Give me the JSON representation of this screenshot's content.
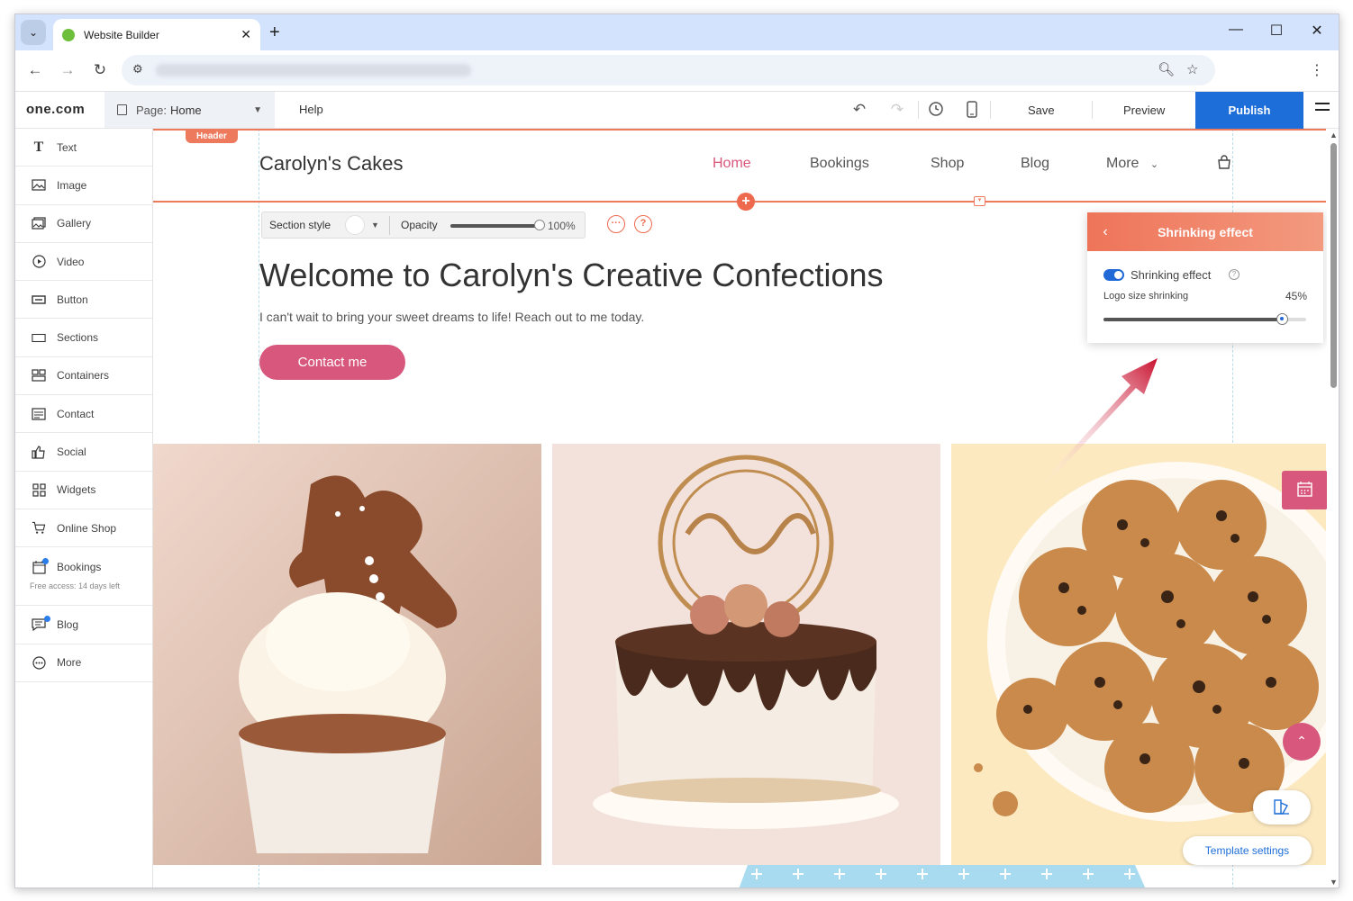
{
  "browser": {
    "tab_title": "Website Builder",
    "new_tab": "+",
    "window_controls": {
      "minimize": "—",
      "maximize": "☐",
      "close": "✕"
    }
  },
  "builder": {
    "logo": "one.com",
    "page_label": "Page:",
    "page_value": "Home",
    "help": "Help",
    "save": "Save",
    "preview": "Preview",
    "publish": "Publish"
  },
  "sidebar": {
    "items": [
      {
        "label": "Text",
        "icon": "text-icon"
      },
      {
        "label": "Image",
        "icon": "image-icon"
      },
      {
        "label": "Gallery",
        "icon": "gallery-icon"
      },
      {
        "label": "Video",
        "icon": "video-icon"
      },
      {
        "label": "Button",
        "icon": "button-icon"
      },
      {
        "label": "Sections",
        "icon": "sections-icon"
      },
      {
        "label": "Containers",
        "icon": "containers-icon"
      },
      {
        "label": "Contact",
        "icon": "contact-icon"
      },
      {
        "label": "Social",
        "icon": "social-icon"
      },
      {
        "label": "Widgets",
        "icon": "widgets-icon"
      },
      {
        "label": "Online Shop",
        "icon": "cart-icon"
      },
      {
        "label": "Bookings",
        "icon": "bookings-icon",
        "sub": "Free access: 14 days left"
      },
      {
        "label": "Blog",
        "icon": "blog-icon"
      },
      {
        "label": "More",
        "icon": "more-icon"
      }
    ]
  },
  "canvas": {
    "header_tag": "Header",
    "site_title": "Carolyn's Cakes",
    "nav": [
      "Home",
      "Bookings",
      "Shop",
      "Blog",
      "More"
    ],
    "section_toolbar": {
      "style_label": "Section style",
      "opacity_label": "Opacity",
      "opacity_value": "100%",
      "opacity_fraction": 1.0
    },
    "hero_title": "Welcome to Carolyn's Creative Confections",
    "hero_sub": "I can't wait to bring your sweet dreams to life! Reach out to me today.",
    "contact_button": "Contact me",
    "images": [
      {
        "name": "cupcake-image",
        "alt": "cupcake with gingerbread man"
      },
      {
        "name": "cake-image",
        "alt": "drip cake with topper"
      },
      {
        "name": "cookies-image",
        "alt": "chocolate chip cookies"
      }
    ],
    "template_settings": "Template settings"
  },
  "shrink_panel": {
    "title": "Shrinking effect",
    "toggle_label": "Shrinking effect",
    "toggle_on": true,
    "slider_label": "Logo size shrinking",
    "slider_value": "45%",
    "slider_fraction": 0.88
  },
  "colors": {
    "accent": "#ee7a5d",
    "brand_pink": "#d7577d",
    "publish_blue": "#1d6ed8"
  }
}
